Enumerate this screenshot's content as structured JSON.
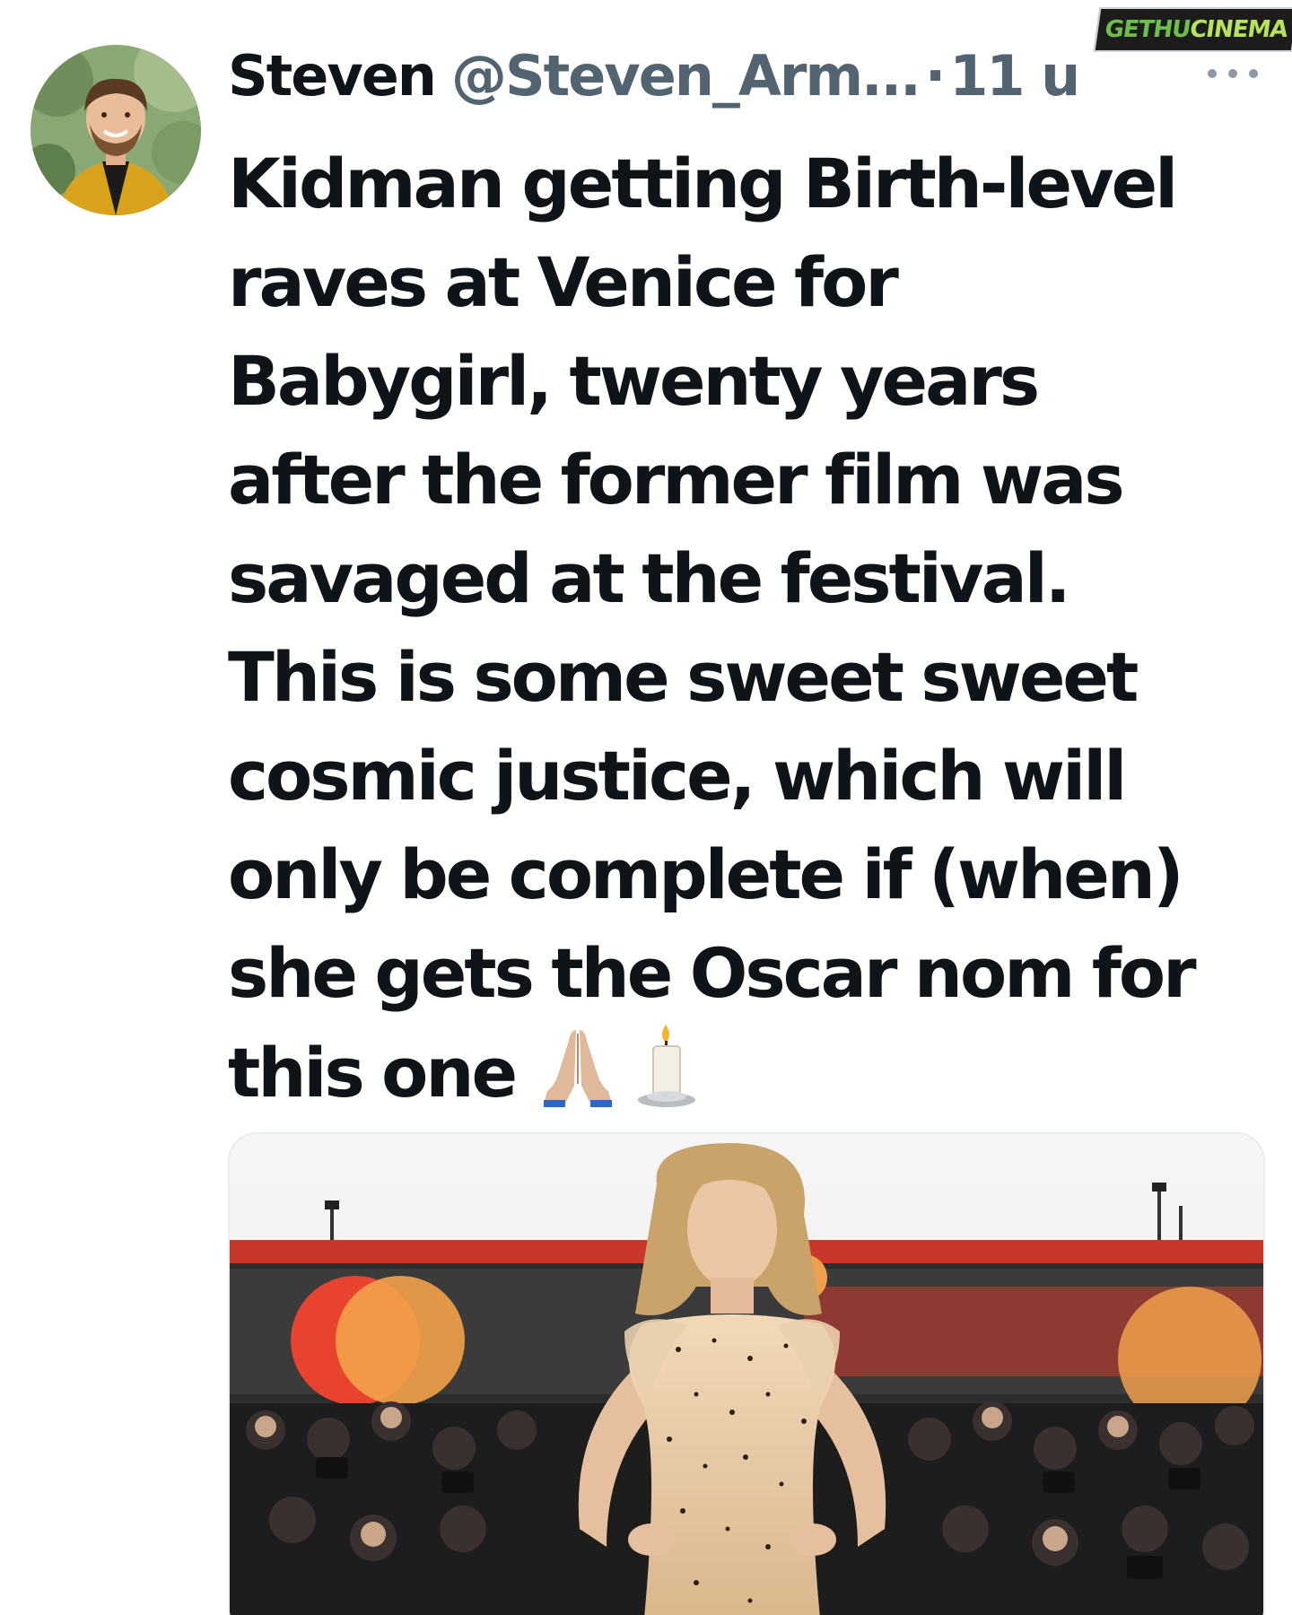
{
  "tweet": {
    "display_name": "Steven",
    "handle": "@Steven_Arm...",
    "separator": "·",
    "timestamp": "11 u",
    "more_icon": "more-horizontal-icon",
    "text_lines": [
      "Kidman getting Birth-level",
      "raves at Venice for",
      "Babygirl, twenty years",
      "after the former film was",
      "savaged at the festival.",
      "This is some sweet sweet",
      "cosmic justice, which will",
      "only be complete if (when)",
      "she gets the Oscar nom for",
      "this one"
    ],
    "emojis": [
      "folded-hands-icon",
      "candle-icon"
    ],
    "media_alt_icon": "red-carpet-photo"
  },
  "watermark": {
    "part_a": "GETHU",
    "part_b": "CINEMA"
  },
  "colors": {
    "text_primary": "#0f1419",
    "text_secondary": "#536471",
    "watermark_green": "#6cc04a",
    "watermark_lime": "#b6e35a"
  }
}
